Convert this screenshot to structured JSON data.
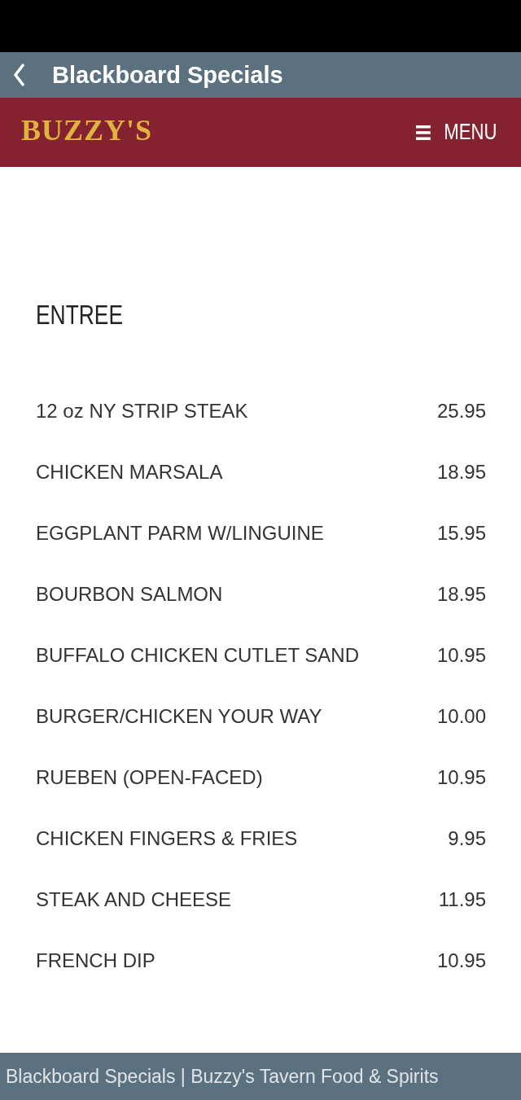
{
  "app_bar": {
    "title": "Blackboard Specials"
  },
  "site_header": {
    "logo": "BUZZY'S",
    "menu_label": "MENU"
  },
  "section": {
    "title": "ENTREE",
    "items": [
      {
        "name": "12 oz NY STRIP STEAK",
        "price": "25.95"
      },
      {
        "name": "CHICKEN MARSALA",
        "price": "18.95"
      },
      {
        "name": "EGGPLANT PARM W/LINGUINE",
        "price": "15.95"
      },
      {
        "name": "BOURBON SALMON",
        "price": "18.95"
      },
      {
        "name": "BUFFALO CHICKEN CUTLET SAND",
        "price": "10.95"
      },
      {
        "name": "BURGER/CHICKEN YOUR WAY",
        "price": "10.00"
      },
      {
        "name": "RUEBEN (OPEN-FACED)",
        "price": "10.95"
      },
      {
        "name": "CHICKEN FINGERS & FRIES",
        "price": "9.95"
      },
      {
        "name": "STEAK AND CHEESE",
        "price": "11.95"
      },
      {
        "name": "FRENCH DIP",
        "price": "10.95"
      }
    ]
  },
  "footer": {
    "page_title": "Blackboard Specials | Buzzy's Tavern Food & Spirits"
  }
}
